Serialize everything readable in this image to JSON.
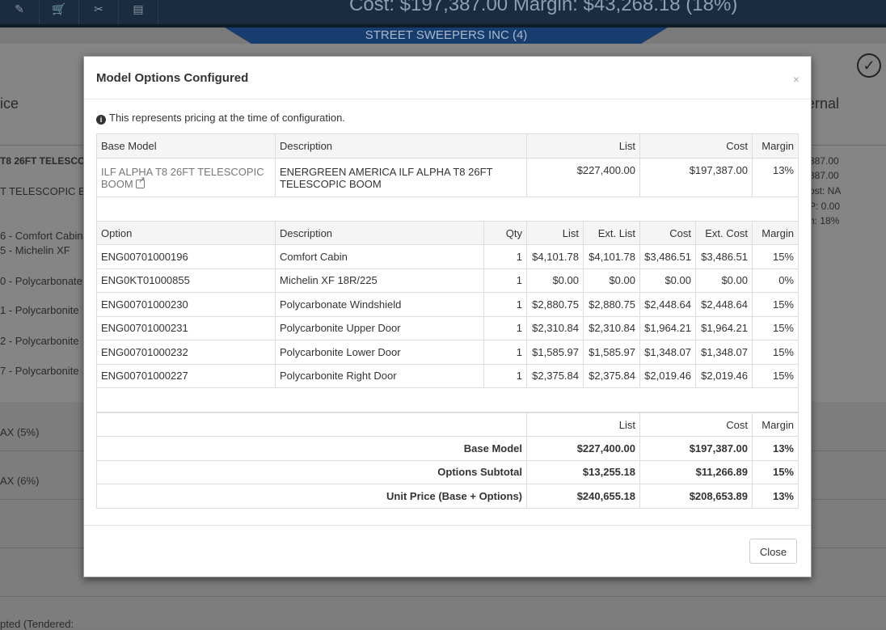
{
  "background": {
    "header_cost": "Cost: $197,387.00 Margin: $43,268.18 (18%)",
    "customer_banner": "STREET SWEEPERS INC (4)",
    "left_heading": "ice",
    "right_heading": "ernal",
    "left_items": [
      "T8 26FT TELESCO",
      "T TELESCOPIC BO",
      "6 - Comfort Cabin",
      "5 - Michelin XF",
      "0 - Polycarbonate",
      "1 - Polycarbonite",
      "2 - Polycarbonite",
      "7 - Polycarbonite"
    ],
    "right_items": [
      "387.00",
      "387.00",
      "ost: NA",
      "P: 0.00",
      "n: 18%"
    ],
    "tax_items": [
      "AX (5%)",
      "AX (6%)"
    ],
    "bottom_text": "pted (Tendered:"
  },
  "modal": {
    "title": "Model Options Configured",
    "close_x": "×",
    "info": "This represents pricing at the time of configuration.",
    "info_icon": "info-circle-icon",
    "base_table": {
      "headers": [
        "Base Model",
        "Description",
        "List",
        "Cost",
        "Margin"
      ],
      "row": {
        "model_line1": "ILF ALPHA T8 26FT TELESCOPIC",
        "model_line2": "BOOM",
        "description_line1": "ENERGREEN AMERICA ILF ALPHA T8 26FT",
        "description_line2": "TELESCOPIC BOOM",
        "list": "$227,400.00",
        "cost": "$197,387.00",
        "margin": "13%"
      }
    },
    "options_table": {
      "headers": [
        "Option",
        "Description",
        "Qty",
        "List",
        "Ext. List",
        "Cost",
        "Ext. Cost",
        "Margin"
      ],
      "rows": [
        {
          "option": "ENG00701000196",
          "description": "Comfort Cabin",
          "qty": "1",
          "list": "$4,101.78",
          "ext_list": "$4,101.78",
          "cost": "$3,486.51",
          "ext_cost": "$3,486.51",
          "margin": "15%"
        },
        {
          "option": "ENG0KT01000855",
          "description": "Michelin XF 18R/225",
          "qty": "1",
          "list": "$0.00",
          "ext_list": "$0.00",
          "cost": "$0.00",
          "ext_cost": "$0.00",
          "margin": "0%"
        },
        {
          "option": "ENG00701000230",
          "description": "Polycarbonate Windshield",
          "qty": "1",
          "list": "$2,880.75",
          "ext_list": "$2,880.75",
          "cost": "$2,448.64",
          "ext_cost": "$2,448.64",
          "margin": "15%"
        },
        {
          "option": "ENG00701000231",
          "description": "Polycarbonite Upper Door",
          "qty": "1",
          "list": "$2,310.84",
          "ext_list": "$2,310.84",
          "cost": "$1,964.21",
          "ext_cost": "$1,964.21",
          "margin": "15%"
        },
        {
          "option": "ENG00701000232",
          "description": "Polycarbonite Lower Door",
          "qty": "1",
          "list": "$1,585.97",
          "ext_list": "$1,585.97",
          "cost": "$1,348.07",
          "ext_cost": "$1,348.07",
          "margin": "15%"
        },
        {
          "option": "ENG00701000227",
          "description": "Polycarbonite Right Door",
          "qty": "1",
          "list": "$2,375.84",
          "ext_list": "$2,375.84",
          "cost": "$2,019.46",
          "ext_cost": "$2,019.46",
          "margin": "15%"
        }
      ]
    },
    "summary_table": {
      "headers": [
        "",
        "List",
        "Cost",
        "Margin"
      ],
      "rows": [
        {
          "label": "Base Model",
          "list": "$227,400.00",
          "cost": "$197,387.00",
          "margin": "13%"
        },
        {
          "label": "Options Subtotal",
          "list": "$13,255.18",
          "cost": "$11,266.89",
          "margin": "15%"
        },
        {
          "label": "Unit Price (Base + Options)",
          "list": "$240,655.18",
          "cost": "$208,653.89",
          "margin": "13%"
        }
      ]
    },
    "close_button": "Close"
  }
}
